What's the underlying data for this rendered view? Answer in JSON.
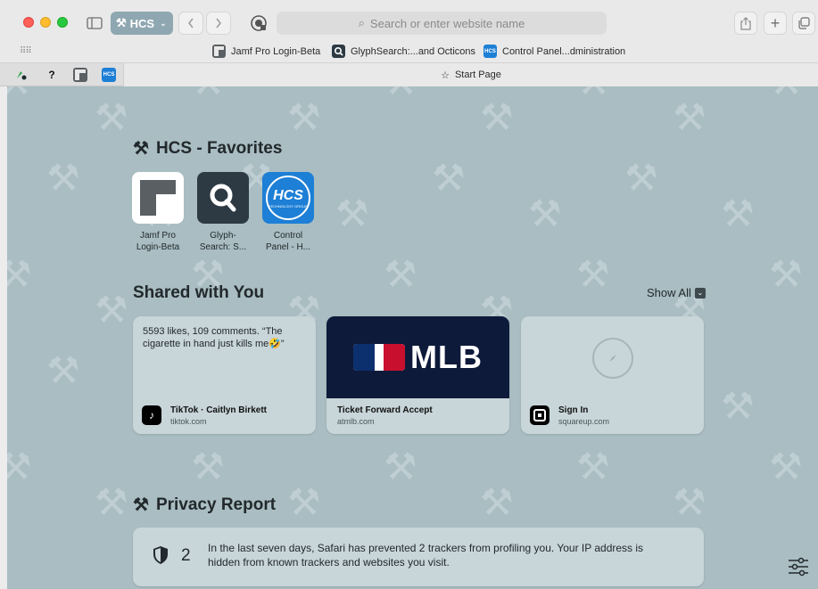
{
  "colors": {
    "window_bg": "#e9e9e9",
    "start_page_bg": "#a9bdc2",
    "card_bg": "#c8d5d9",
    "tab_group_bg": "#8fa7b1",
    "text_dark": "#22292c"
  },
  "toolbar": {
    "tab_group_label": "HCS",
    "address_placeholder": "Search or enter website name"
  },
  "favorites_bar": {
    "items": [
      {
        "label": "Jamf Pro Login-Beta",
        "icon": "jamf-icon"
      },
      {
        "label": "GlyphSearch:...and Octicons",
        "icon": "glyphsearch-icon"
      },
      {
        "label": "Control Panel...dministration",
        "icon": "hcs-icon"
      }
    ]
  },
  "tab_bar": {
    "pinned": [
      {
        "icon": "green-leaf-icon"
      },
      {
        "icon": "question-icon"
      },
      {
        "icon": "jamf-icon"
      },
      {
        "icon": "hcs-icon",
        "text": "HCS"
      }
    ],
    "active_tab_label": "Start Page"
  },
  "start_page": {
    "favorites": {
      "title": "HCS - Favorites",
      "tiles": [
        {
          "label_line1": "Jamf Pro",
          "label_line2": "Login-Beta"
        },
        {
          "label_line1": "Glyph-",
          "label_line2": "Search: S..."
        },
        {
          "label_line1": "Control",
          "label_line2": "Panel - H...",
          "logo_text": "HCS",
          "logo_sub": "TECHNOLOGY GROUP"
        }
      ]
    },
    "shared": {
      "title": "Shared with You",
      "show_all": "Show All",
      "cards": [
        {
          "text": "5593 likes, 109 comments. “The cigarette in hand just kills me🤣”",
          "title": "TikTok · Caitlyn Birkett",
          "domain": "tiktok.com",
          "icon_glyph": "♪"
        },
        {
          "banner": "MLB",
          "title": "Ticket Forward Accept",
          "domain": "atmlb.com"
        },
        {
          "title": "Sign In",
          "domain": "squareup.com",
          "icon_glyph": "■"
        }
      ]
    },
    "privacy": {
      "title": "Privacy Report",
      "count": "2",
      "text": "In the last seven days, Safari has prevented 2 trackers from profiling you. Your IP address is hidden from known trackers and websites you visit."
    }
  }
}
